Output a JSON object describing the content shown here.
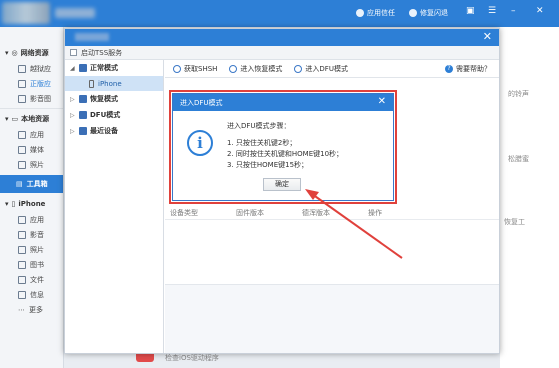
{
  "app": {
    "top_buttons": [
      "应用信任",
      "修复闪退"
    ],
    "colors": {
      "accent": "#2d7fd6",
      "highlight": "#e0413c"
    }
  },
  "leftnav": {
    "group1": "网络资源",
    "group1_items": [
      "越狱应",
      "正版应",
      "影音图"
    ],
    "group2": "本地资源",
    "group2_items": [
      "应用",
      "媒体",
      "照片"
    ],
    "toolbox": "工具箱",
    "group3": "iPhone",
    "group3_items": [
      "应用",
      "影音",
      "照片",
      "图书",
      "文件",
      "信息",
      "更多"
    ]
  },
  "background_right": {
    "texts": [
      "的铃声",
      "松腊蜜",
      "恢复工"
    ]
  },
  "background_bottom": "检查iOS驱动程序",
  "toolbox_window": {
    "tss_label": "启动TSS服务",
    "tree": [
      {
        "label": "正常模式",
        "children": [
          "iPhone"
        ]
      },
      {
        "label": "恢复模式",
        "children": []
      },
      {
        "label": "DFU模式",
        "children": []
      },
      {
        "label": "最近设备",
        "children": []
      }
    ],
    "toolbar": [
      "获取SHSH",
      "进入恢复模式",
      "进入DFU模式"
    ],
    "help": "需要帮助？",
    "table_headers": [
      "设备类型",
      "固件版本",
      "德浑版本",
      "操作"
    ]
  },
  "dialog": {
    "title": "进入DFU模式",
    "intro": "进入DFU模式步骤：",
    "steps": [
      "1. 只按住关机键2秒；",
      "2. 同时按住关机键和HOME键10秒；",
      "3. 只按住HOME键15秒；"
    ],
    "ok": "确定",
    "icon": "info-icon"
  }
}
